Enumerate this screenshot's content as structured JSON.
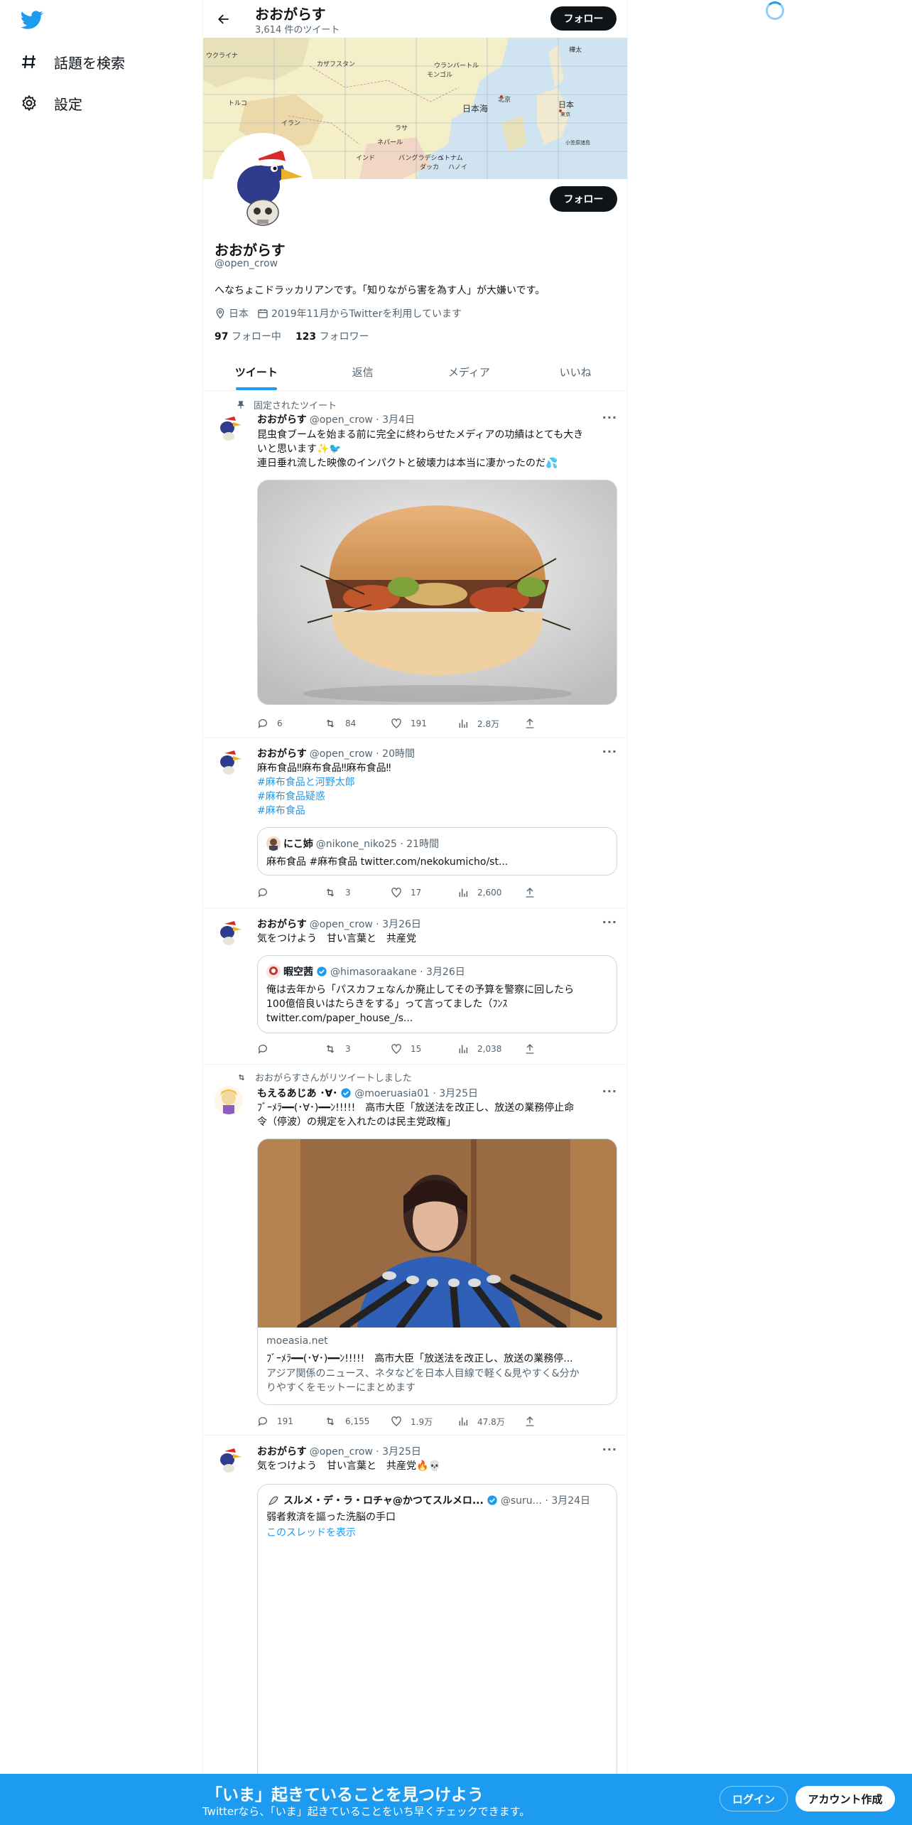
{
  "nav": {
    "items": [
      {
        "label": "話題を検索",
        "icon": "hashtag-icon"
      },
      {
        "label": "設定",
        "icon": "gear-icon"
      }
    ]
  },
  "header": {
    "name": "おおがらす",
    "tweet_count": "3,614 件のツイート",
    "follow_label": "フォロー"
  },
  "banner": {
    "labels": [
      "ウクライナ",
      "カザフスタン",
      "モンゴル",
      "ウランバートル",
      "樺太",
      "トルコ",
      "イラン",
      "日本海",
      "日本",
      "東京",
      "インド",
      "ラサ",
      "ベトナム",
      "ネパール",
      "ダッカ",
      "ハノイ",
      "バングラデシュ",
      "小笠原諸島",
      "北京"
    ]
  },
  "profile": {
    "name": "おおがらす",
    "handle": "@open_crow",
    "bio": "へなちょこドラッカリアンです。「知りながら害を為す人」が大嫌いです。",
    "location": "日本",
    "joined": "2019年11月からTwitterを利用しています",
    "following_count": "97",
    "following_label": "フォロー中",
    "followers_count": "123",
    "followers_label": "フォロワー",
    "follow_label": "フォロー"
  },
  "tabs": [
    "ツイート",
    "返信",
    "メディア",
    "いいね"
  ],
  "tweets": [
    {
      "context": "固定されたツイート",
      "name": "おおがらす",
      "meta": "@open_crow · 3月4日",
      "lines": [
        "昆虫食ブームを始まる前に完全に終わらせたメディアの功績はとても大き",
        "いと思います✨🐦",
        "連日垂れ流した映像のインパクトと破壊力は本当に凄かったのだ💦"
      ],
      "stats": {
        "reply": "6",
        "retweet": "84",
        "like": "191",
        "views": "2.8万"
      }
    },
    {
      "name": "おおがらす",
      "meta": "@open_crow · 20時間",
      "lines": [
        "麻布食品‼麻布食品‼麻布食品‼"
      ],
      "hashtags": [
        "#麻布食品と河野太郎",
        "#麻布食品疑惑",
        "#麻布食品"
      ],
      "quote": {
        "name": "にこ姉",
        "meta": "@nikone_niko25 · 21時間",
        "text": "麻布食品 #麻布食品 twitter.com/nekokumicho/st..."
      },
      "stats": {
        "reply": "",
        "retweet": "3",
        "like": "17",
        "views": "2,600"
      }
    },
    {
      "name": "おおがらす",
      "meta": "@open_crow · 3月26日",
      "lines": [
        "気をつけよう　甘い言葉と　共産党"
      ],
      "quote": {
        "name": "暇空茜",
        "meta": "@himasoraakane · 3月26日",
        "lines": [
          "俺は去年から「パスカフェなんか廃止してその予算を警察に回したら",
          "100億倍良いはたらきをする」って言ってました（ﾌﾝｽ",
          "twitter.com/paper_house_/s..."
        ]
      },
      "stats": {
        "reply": "",
        "retweet": "3",
        "like": "15",
        "views": "2,038"
      }
    },
    {
      "context": "おおがらすさんがリツイートしました",
      "name": "もえるあじあ ･∀･",
      "meta": "@moeruasia01 · 3月25日",
      "lines": [
        "ﾌﾞｰﾒﾗ━━(･∀･)━━ﾝ!!!!!　高市大臣「放送法を改正し、放送の業務停止命",
        "令（停波）の規定を入れたのは民主党政権」"
      ],
      "card": {
        "domain": "moeasia.net",
        "title": "ﾌﾞｰﾒﾗ━━(･∀･)━━ﾝ!!!!!　高市大臣「放送法を改正し、放送の業務停...",
        "desc_lines": [
          "アジア関係のニュース、ネタなどを日本人目線で軽く&見やすく&分か",
          "りやすくをモットーにまとめます"
        ]
      },
      "stats": {
        "reply": "191",
        "retweet": "6,155",
        "like": "1.9万",
        "views": "47.8万"
      }
    },
    {
      "name": "おおがらす",
      "meta": "@open_crow · 3月25日",
      "lines": [
        "気をつけよう　甘い言葉と　共産党🔥💀"
      ],
      "quote": {
        "name": "スルメ・デ・ラ・ロチャ@かつてスルメロ...",
        "meta": "@suru... · 3月24日",
        "text": "弱者救済を謳った洗脳の手口",
        "link": "このスレッドを表示"
      }
    }
  ],
  "bottom": {
    "title": "「いま」起きていることを見つけよう",
    "subtitle": "Twitterなら、「いま」起きていることをいち早くチェックできます。",
    "login": "ログイン",
    "signup": "アカウント作成"
  },
  "colors": {
    "accent": "#1d9bf0",
    "text": "#0f1419",
    "muted": "#536471",
    "border": "#eff3f4"
  }
}
